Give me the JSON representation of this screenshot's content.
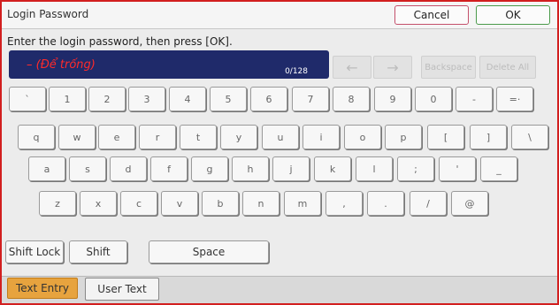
{
  "header": {
    "title": "Login Password",
    "cancel_label": "Cancel",
    "ok_label": "OK"
  },
  "instruction": "Enter the login password, then press [OK].",
  "input": {
    "value": "– (Để trống)",
    "counter": "0/128"
  },
  "controls": {
    "left_arrow": "←",
    "right_arrow": "→",
    "backspace_label": "Backspace",
    "delete_all_label": "Delete All"
  },
  "keyboard": {
    "row1": [
      "`",
      "1",
      "2",
      "3",
      "4",
      "5",
      "6",
      "7",
      "8",
      "9",
      "0",
      "-",
      "=·"
    ],
    "row2": [
      "q",
      "w",
      "e",
      "r",
      "t",
      "y",
      "u",
      "i",
      "o",
      "p",
      "[",
      "]",
      "\\"
    ],
    "row3": [
      "a",
      "s",
      "d",
      "f",
      "g",
      "h",
      "j",
      "k",
      "l",
      ";",
      "'",
      "_"
    ],
    "row4": [
      "z",
      "x",
      "c",
      "v",
      "b",
      "n",
      "m",
      ",",
      ".",
      "/",
      "@"
    ],
    "shift_lock_label": "Shift Lock",
    "shift_label": "Shift",
    "space_label": "Space"
  },
  "tabs": {
    "text_entry_label": "Text Entry",
    "user_text_label": "User Text"
  },
  "colors": {
    "frame_border": "#d21f1f",
    "input_background": "#1f2a6a",
    "input_placeholder_text": "#ff2a2a",
    "active_tab": "#e7a33e"
  }
}
